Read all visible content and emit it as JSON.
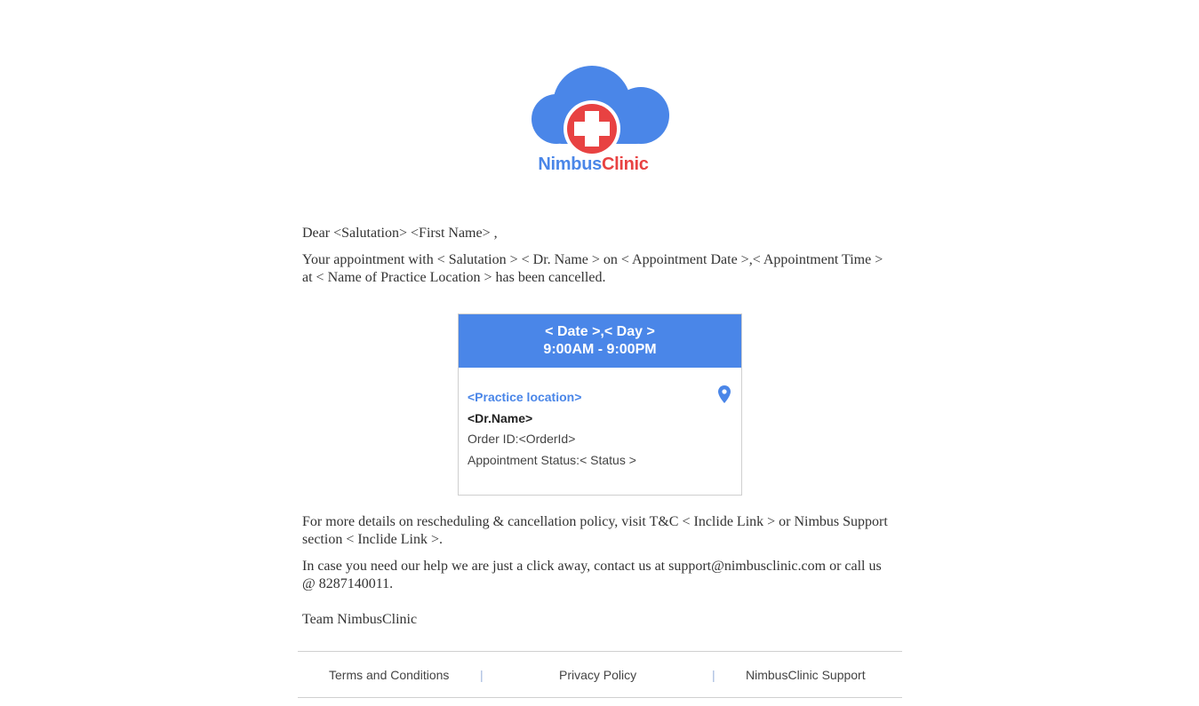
{
  "brand": {
    "name_part1": "Nimbus",
    "name_part2": "Clinic",
    "primary_color": "#4a86e8",
    "accent_color": "#e84242"
  },
  "greeting": "Dear <Salutation> <First Name> ,",
  "message": "Your appointment with < Salutation > < Dr. Name > on < Appointment Date >,< Appointment Time > at < Name of Practice Location > has been cancelled.",
  "card": {
    "date_day": "< Date >,< Day >",
    "time_range": "9:00AM - 9:00PM",
    "location": "<Practice location>",
    "doctor": "<Dr.Name>",
    "order_id": "Order ID:<OrderId>",
    "status": "Appointment Status:< Status >",
    "location_icon": "map-pin-icon"
  },
  "details": "For more details on rescheduling & cancellation policy, visit T&C < Inclide Link > or Nimbus Support section < Inclide Link >.",
  "help": "In case you need our help we are just a click away, contact us at support@nimbusclinic.com or call us @ 8287140011.",
  "signoff": "Team NimbusClinic",
  "footer": {
    "terms": "Terms and Conditions",
    "privacy": "Privacy Policy",
    "support": "NimbusClinic Support",
    "separator": "|"
  }
}
